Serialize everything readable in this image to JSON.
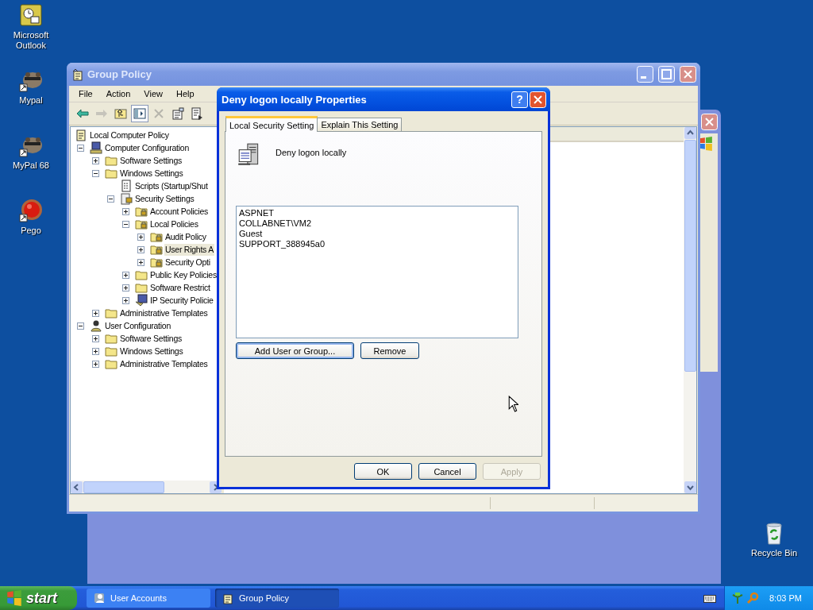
{
  "desktop_icons": [
    {
      "label": "Microsoft Outlook",
      "kind": "outlook"
    },
    {
      "label": "Mypal",
      "kind": "raccoon"
    },
    {
      "label": "MyPal 68",
      "kind": "raccoon"
    },
    {
      "label": "Pego",
      "kind": "pego"
    }
  ],
  "recycle_bin": {
    "label": "Recycle Bin"
  },
  "group_policy": {
    "title": "Group Policy",
    "menu": [
      "File",
      "Action",
      "View",
      "Help"
    ],
    "toolbar": [
      {
        "kind": "back",
        "disabled": false,
        "pressed": false
      },
      {
        "kind": "forward",
        "disabled": true,
        "pressed": false
      },
      {
        "kind": "up",
        "disabled": false,
        "pressed": false
      },
      {
        "kind": "showhide",
        "disabled": false,
        "pressed": true
      },
      {
        "kind": "delete",
        "disabled": true,
        "pressed": false
      },
      {
        "kind": "properties",
        "disabled": false,
        "pressed": false
      },
      {
        "kind": "export",
        "disabled": false,
        "pressed": false
      }
    ],
    "tree": [
      {
        "label": "Local Computer Policy",
        "kind": "policy",
        "selected": false,
        "children": [
          {
            "label": "Computer Configuration",
            "kind": "computer",
            "expanded": true,
            "selected": false,
            "children": [
              {
                "label": "Software Settings",
                "kind": "folder",
                "expanded": false,
                "selected": false
              },
              {
                "label": "Windows Settings",
                "kind": "folder",
                "expanded": true,
                "selected": false,
                "children": [
                  {
                    "label": "Scripts (Startup/Shut",
                    "kind": "script",
                    "selected": false
                  },
                  {
                    "label": "Security Settings",
                    "kind": "security",
                    "expanded": true,
                    "selected": false,
                    "children": [
                      {
                        "label": "Account Policies",
                        "kind": "lockfolder",
                        "expanded": false,
                        "selected": false
                      },
                      {
                        "label": "Local Policies",
                        "kind": "lockfolder",
                        "expanded": true,
                        "selected": false,
                        "children": [
                          {
                            "label": "Audit Policy",
                            "kind": "lockfolder",
                            "expanded": false,
                            "selected": false
                          },
                          {
                            "label": "User Rights A",
                            "kind": "lockfolder",
                            "expanded": false,
                            "selected": true
                          },
                          {
                            "label": "Security Opti",
                            "kind": "lockfolder",
                            "expanded": false,
                            "selected": false
                          }
                        ]
                      },
                      {
                        "label": "Public Key Policies",
                        "kind": "folder",
                        "expanded": false,
                        "selected": false
                      },
                      {
                        "label": "Software Restrict",
                        "kind": "folder",
                        "expanded": false,
                        "selected": false
                      },
                      {
                        "label": "IP Security Policie",
                        "kind": "ipsec",
                        "expanded": false,
                        "selected": false
                      }
                    ]
                  }
                ]
              },
              {
                "label": "Administrative Templates",
                "kind": "folder",
                "expanded": false,
                "selected": false
              }
            ]
          },
          {
            "label": "User Configuration",
            "kind": "user",
            "expanded": true,
            "selected": false,
            "children": [
              {
                "label": "Software Settings",
                "kind": "folder",
                "expanded": false,
                "selected": false
              },
              {
                "label": "Windows Settings",
                "kind": "folder",
                "expanded": false,
                "selected": false
              },
              {
                "label": "Administrative Templates",
                "kind": "folder",
                "expanded": false,
                "selected": false
              }
            ]
          }
        ]
      }
    ]
  },
  "dialog": {
    "title": "Deny logon locally Properties",
    "help_button": "?",
    "tabs": [
      {
        "label": "Local Security Setting",
        "selected": true
      },
      {
        "label": "Explain This Setting",
        "selected": false
      }
    ],
    "setting_name": "Deny logon locally",
    "members": [
      "ASPNET",
      "COLLABNET\\VM2",
      "Guest",
      "SUPPORT_388945a0"
    ],
    "list_buttons": [
      {
        "label": "Add User or Group...",
        "focused": true
      },
      {
        "label": "Remove",
        "focused": false
      }
    ],
    "buttons": [
      {
        "label": "OK",
        "disabled": false
      },
      {
        "label": "Cancel",
        "disabled": false
      },
      {
        "label": "Apply",
        "disabled": true
      }
    ]
  },
  "taskbar": {
    "start": "start",
    "tasks": [
      {
        "label": "User Accounts",
        "kind": "users",
        "selected": false
      },
      {
        "label": "Group Policy",
        "kind": "policy",
        "selected": true
      }
    ],
    "clock": "8:03 PM"
  }
}
